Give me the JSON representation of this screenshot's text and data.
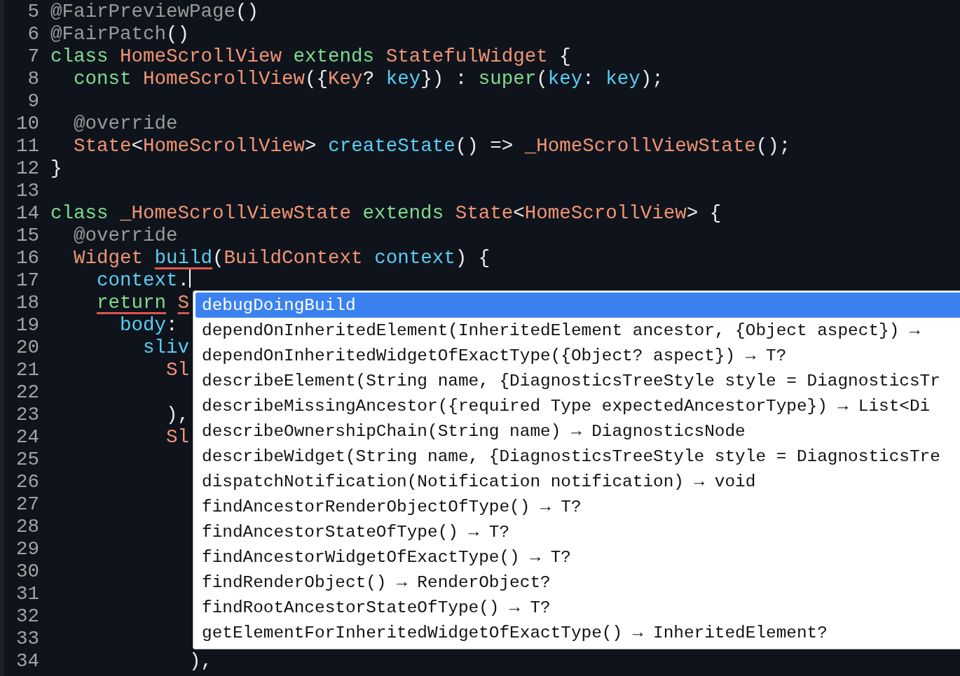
{
  "editor": {
    "lines": [
      {
        "number": "5",
        "cursor": false,
        "tokens": [
          {
            "text": "@FairPreviewPage",
            "kind": "annotation",
            "error": false
          },
          {
            "text": "()",
            "kind": "plain",
            "error": false
          }
        ]
      },
      {
        "number": "6",
        "cursor": false,
        "tokens": [
          {
            "text": "@FairPatch",
            "kind": "annotation",
            "error": false
          },
          {
            "text": "()",
            "kind": "plain",
            "error": false
          }
        ]
      },
      {
        "number": "7",
        "cursor": false,
        "tokens": [
          {
            "text": "class ",
            "kind": "keyword",
            "error": false
          },
          {
            "text": "HomeScrollView ",
            "kind": "type",
            "error": false
          },
          {
            "text": "extends ",
            "kind": "keyword",
            "error": false
          },
          {
            "text": "StatefulWidget ",
            "kind": "type",
            "error": false
          },
          {
            "text": "{",
            "kind": "plain",
            "error": false
          }
        ]
      },
      {
        "number": "8",
        "cursor": false,
        "tokens": [
          {
            "text": "  const ",
            "kind": "keyword",
            "error": false
          },
          {
            "text": "HomeScrollView",
            "kind": "type",
            "error": false
          },
          {
            "text": "({",
            "kind": "plain",
            "error": false
          },
          {
            "text": "Key",
            "kind": "type",
            "error": false
          },
          {
            "text": "? ",
            "kind": "plain",
            "error": false
          },
          {
            "text": "key",
            "kind": "member",
            "error": false
          },
          {
            "text": "}) : ",
            "kind": "plain",
            "error": false
          },
          {
            "text": "super",
            "kind": "keyword",
            "error": false
          },
          {
            "text": "(",
            "kind": "plain",
            "error": false
          },
          {
            "text": "key",
            "kind": "member",
            "error": false
          },
          {
            "text": ": ",
            "kind": "plain",
            "error": false
          },
          {
            "text": "key",
            "kind": "member",
            "error": false
          },
          {
            "text": ");",
            "kind": "plain",
            "error": false
          }
        ]
      },
      {
        "number": "9",
        "cursor": false
      },
      {
        "number": "10",
        "cursor": false,
        "tokens": [
          {
            "text": "  @override",
            "kind": "annotation",
            "error": false
          }
        ]
      },
      {
        "number": "11",
        "cursor": false,
        "tokens": [
          {
            "text": "  State",
            "kind": "type",
            "error": false
          },
          {
            "text": "<",
            "kind": "plain",
            "error": false
          },
          {
            "text": "HomeScrollView",
            "kind": "type",
            "error": false
          },
          {
            "text": "> ",
            "kind": "plain",
            "error": false
          },
          {
            "text": "createState",
            "kind": "member",
            "error": false
          },
          {
            "text": "() => ",
            "kind": "plain",
            "error": false
          },
          {
            "text": "_HomeScrollViewState",
            "kind": "type",
            "error": false
          },
          {
            "text": "();",
            "kind": "plain",
            "error": false
          }
        ]
      },
      {
        "number": "12",
        "cursor": false,
        "tokens": [
          {
            "text": "}",
            "kind": "plain",
            "error": false
          }
        ]
      },
      {
        "number": "13",
        "cursor": false
      },
      {
        "number": "14",
        "cursor": false,
        "tokens": [
          {
            "text": "class ",
            "kind": "keyword",
            "error": false
          },
          {
            "text": "_HomeScrollViewState ",
            "kind": "type",
            "error": false
          },
          {
            "text": "extends ",
            "kind": "keyword",
            "error": false
          },
          {
            "text": "State",
            "kind": "type",
            "error": false
          },
          {
            "text": "<",
            "kind": "plain",
            "error": false
          },
          {
            "text": "HomeScrollView",
            "kind": "type",
            "error": false
          },
          {
            "text": "> {",
            "kind": "plain",
            "error": false
          }
        ]
      },
      {
        "number": "15",
        "cursor": false,
        "tokens": [
          {
            "text": "  @override",
            "kind": "annotation",
            "error": false
          }
        ]
      },
      {
        "number": "16",
        "cursor": false,
        "tokens": [
          {
            "text": "  Widget ",
            "kind": "type",
            "error": false
          },
          {
            "text": "build",
            "kind": "member",
            "error": true
          },
          {
            "text": "(",
            "kind": "plain",
            "error": false
          },
          {
            "text": "BuildContext ",
            "kind": "type",
            "error": false
          },
          {
            "text": "context",
            "kind": "member",
            "error": false
          },
          {
            "text": ") {",
            "kind": "plain",
            "error": false
          }
        ]
      },
      {
        "number": "17",
        "cursor": true,
        "tokens": [
          {
            "text": "    context",
            "kind": "member",
            "error": false
          },
          {
            "text": ".",
            "kind": "plain",
            "error": false
          }
        ]
      },
      {
        "number": "18",
        "cursor": false,
        "tokens": [
          {
            "text": "    return ",
            "kind": "keyword",
            "error": true
          },
          {
            "text": "S",
            "kind": "type",
            "error": true
          }
        ]
      },
      {
        "number": "19",
        "cursor": false,
        "tokens": [
          {
            "text": "      body",
            "kind": "member",
            "error": false
          },
          {
            "text": ":",
            "kind": "plain",
            "error": false
          }
        ]
      },
      {
        "number": "20",
        "cursor": false,
        "tokens": [
          {
            "text": "        sliv",
            "kind": "member",
            "error": false
          }
        ]
      },
      {
        "number": "21",
        "cursor": false,
        "tokens": [
          {
            "text": "          Sl",
            "kind": "type",
            "error": false
          }
        ]
      },
      {
        "number": "22",
        "cursor": false
      },
      {
        "number": "23",
        "cursor": false,
        "tokens": [
          {
            "text": "          ),",
            "kind": "plain",
            "error": false
          }
        ]
      },
      {
        "number": "24",
        "cursor": false,
        "tokens": [
          {
            "text": "          Sl",
            "kind": "type",
            "error": false
          }
        ]
      },
      {
        "number": "25",
        "cursor": false
      },
      {
        "number": "26",
        "cursor": false
      },
      {
        "number": "27",
        "cursor": false
      },
      {
        "number": "28",
        "cursor": false
      },
      {
        "number": "29",
        "cursor": false
      },
      {
        "number": "30",
        "cursor": false
      },
      {
        "number": "31",
        "cursor": false
      },
      {
        "number": "32",
        "cursor": false
      },
      {
        "number": "33",
        "cursor": false
      },
      {
        "number": "34",
        "cursor": false,
        "tokens": [
          {
            "text": "            ),",
            "kind": "plain",
            "error": false
          }
        ]
      }
    ]
  },
  "completion_popup": {
    "items": [
      {
        "label": "debugDoingBuild",
        "selected": true
      },
      {
        "label": "dependOnInheritedElement(InheritedElement ancestor, {Object aspect}) →",
        "selected": false
      },
      {
        "label": "dependOnInheritedWidgetOfExactType({Object? aspect}) → T?",
        "selected": false
      },
      {
        "label": "describeElement(String name, {DiagnosticsTreeStyle style = DiagnosticsTr",
        "selected": false
      },
      {
        "label": "describeMissingAncestor({required Type expectedAncestorType}) → List<Di",
        "selected": false
      },
      {
        "label": "describeOwnershipChain(String name) → DiagnosticsNode",
        "selected": false
      },
      {
        "label": "describeWidget(String name, {DiagnosticsTreeStyle style = DiagnosticsTre",
        "selected": false
      },
      {
        "label": "dispatchNotification(Notification notification) → void",
        "selected": false
      },
      {
        "label": "findAncestorRenderObjectOfType() → T?",
        "selected": false
      },
      {
        "label": "findAncestorStateOfType() → T?",
        "selected": false
      },
      {
        "label": "findAncestorWidgetOfExactType() → T?",
        "selected": false
      },
      {
        "label": "findRenderObject() → RenderObject?",
        "selected": false
      },
      {
        "label": "findRootAncestorStateOfType() → T?",
        "selected": false
      },
      {
        "label": "getElementForInheritedWidgetOfExactType() → InheritedElement?",
        "selected": false
      }
    ]
  }
}
